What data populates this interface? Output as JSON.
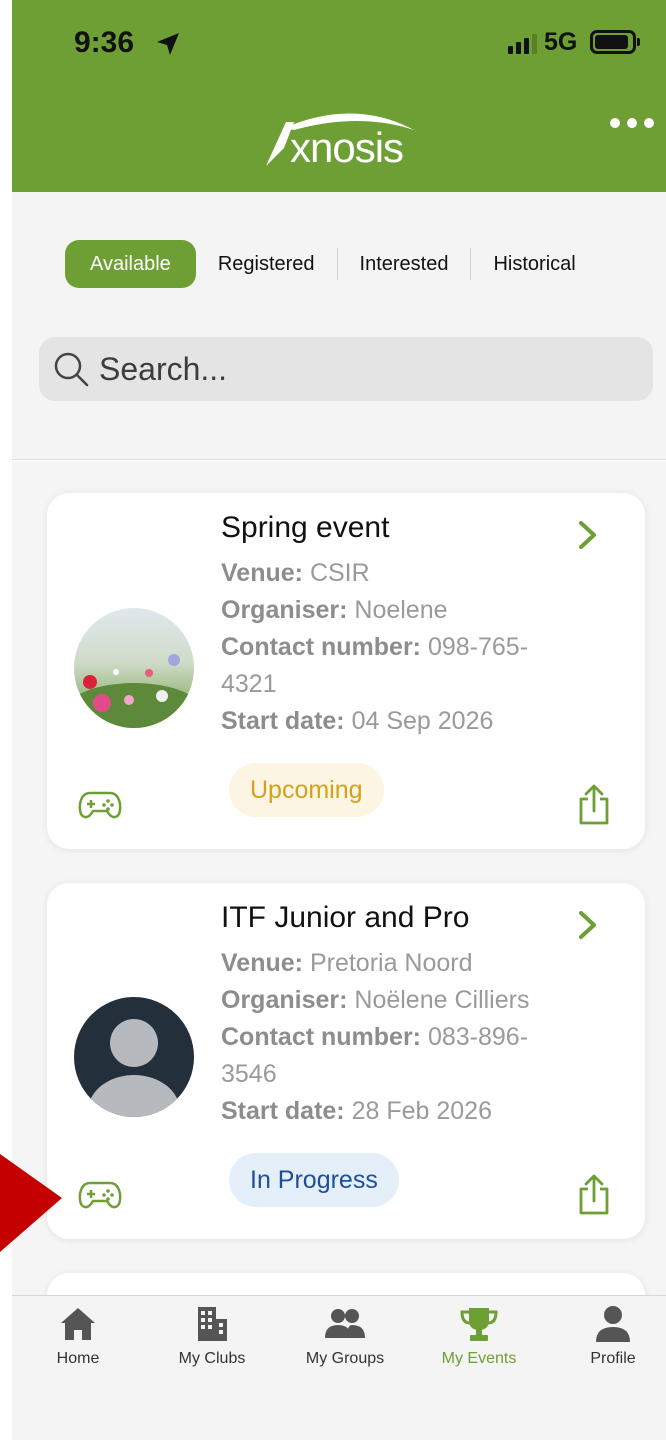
{
  "status_bar": {
    "time": "9:36",
    "network": "5G"
  },
  "header": {
    "logo_text": "xnosis",
    "more_icon": "ellipsis-icon"
  },
  "tabs": [
    {
      "label": "Available",
      "active": true
    },
    {
      "label": "Registered",
      "active": false
    },
    {
      "label": "Interested",
      "active": false
    },
    {
      "label": "Historical",
      "active": false
    }
  ],
  "search": {
    "placeholder": "Search..."
  },
  "events": [
    {
      "title": "Spring event",
      "venue_label": "Venue:",
      "venue": "CSIR",
      "organiser_label": "Organiser:",
      "organiser": "Noelene",
      "contact_label": "Contact number:",
      "contact_line1": "098-765-",
      "contact_line2": "4321",
      "start_label": "Start date:",
      "start_date": "04 Sep 2026",
      "status": "Upcoming",
      "avatar": "flowers-photo"
    },
    {
      "title": "ITF Junior and Pro",
      "venue_label": "Venue:",
      "venue": "Pretoria Noord",
      "organiser_label": "Organiser:",
      "organiser": "Noëlene Cilliers",
      "contact_label": "Contact number:",
      "contact_line1": "083-896-",
      "contact_line2": "3546",
      "start_label": "Start date:",
      "start_date": "28 Feb 2026",
      "status": "In Progress",
      "avatar": "default-person-avatar"
    }
  ],
  "bottom_nav": [
    {
      "label": "Home",
      "icon": "home-icon",
      "active": false
    },
    {
      "label": "My Clubs",
      "icon": "building-icon",
      "active": false
    },
    {
      "label": "My Groups",
      "icon": "people-icon",
      "active": false
    },
    {
      "label": "My Events",
      "icon": "trophy-icon",
      "active": true
    },
    {
      "label": "Profile",
      "icon": "person-icon",
      "active": false
    }
  ],
  "colors": {
    "brand_green": "#6e9f34",
    "upcoming_text": "#d3a21a",
    "upcoming_bg": "#fdf5e3",
    "progress_text": "#1d4f9a",
    "progress_bg": "#e4effa",
    "annotation_arrow": "#c40000"
  }
}
